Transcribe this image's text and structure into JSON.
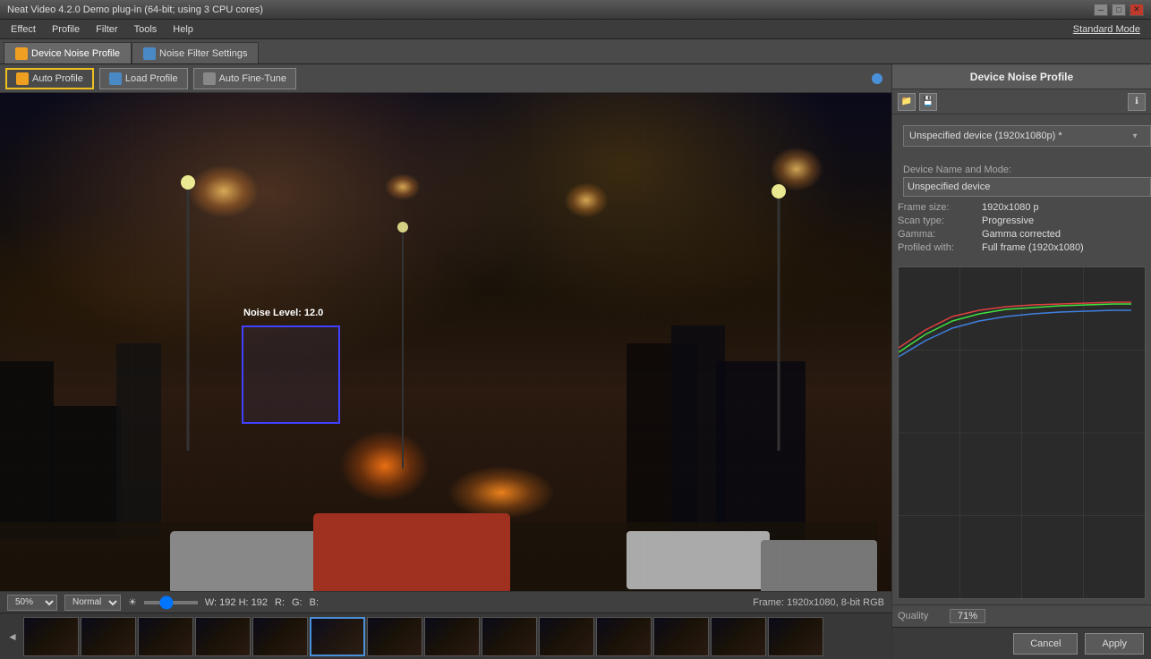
{
  "titlebar": {
    "title": "Neat Video 4.2.0 Demo plug-in (64-bit; using 3 CPU cores)",
    "minimize_label": "─",
    "maximize_label": "□",
    "close_label": "✕"
  },
  "menubar": {
    "items": [
      "Effect",
      "Profile",
      "Filter",
      "Tools",
      "Help"
    ],
    "standard_mode": "Standard Mode"
  },
  "tabs": [
    {
      "label": "Device Noise Profile",
      "icon": "device-icon",
      "active": true
    },
    {
      "label": "Noise Filter Settings",
      "icon": "filter-icon",
      "active": false
    }
  ],
  "toolbar": {
    "auto_profile": "Auto Profile",
    "load_profile": "Load Profile",
    "auto_fine_tune": "Auto Fine-Tune"
  },
  "video": {
    "noise_level_label": "Noise Level: 12.0"
  },
  "statusbar": {
    "zoom": "50%",
    "mode": "Normal",
    "dimensions": "W: 192  H: 192",
    "r_label": "R:",
    "g_label": "G:",
    "b_label": "B:",
    "frame_info": "Frame: 1920x1080, 8-bit RGB"
  },
  "right_panel": {
    "title": "Device Noise Profile",
    "device_dropdown": "Unspecified device (1920x1080p) *",
    "device_name_label": "Device Name and Mode:",
    "device_name_value": "Unspecified device",
    "frame_size_label": "Frame size:",
    "frame_size_value": "1920x1080 p",
    "scan_type_label": "Scan type:",
    "scan_type_value": "Progressive",
    "gamma_label": "Gamma:",
    "gamma_value": "Gamma corrected",
    "profiled_label": "Profiled with:",
    "profiled_value": "Full frame (1920x1080)",
    "quality_label": "Quality",
    "quality_value": "71%"
  },
  "buttons": {
    "cancel": "Cancel",
    "apply": "Apply"
  },
  "filmstrip": {
    "selected_index": 5,
    "frame_count": 14
  }
}
